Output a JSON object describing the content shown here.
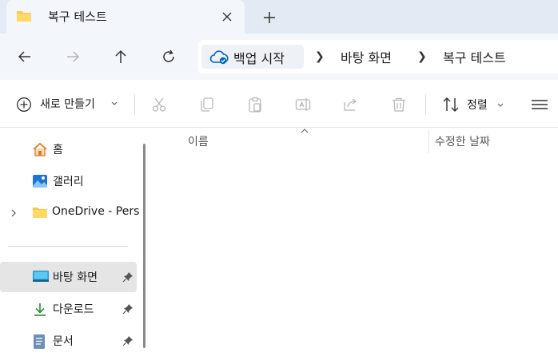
{
  "tab": {
    "title": "복구 테스트"
  },
  "address": {
    "root": "백업 시작",
    "crumbs": [
      "바탕 화면",
      "복구 테스트"
    ]
  },
  "toolbar": {
    "new_label": "새로 만들기",
    "sort_label": "정렬"
  },
  "nav": {
    "items": [
      {
        "label": "홈",
        "icon": "home-icon"
      },
      {
        "label": "갤러리",
        "icon": "gallery-icon"
      },
      {
        "label": "OneDrive - Pers",
        "icon": "folder-icon"
      },
      {
        "label": "바탕 화면",
        "icon": "desktop-icon"
      },
      {
        "label": "다운로드",
        "icon": "download-icon"
      },
      {
        "label": "문서",
        "icon": "document-icon"
      }
    ]
  },
  "columns": {
    "name": "이름",
    "date": "수정한 날짜"
  },
  "colors": {
    "accent": "#0067c0",
    "folder": "#f8c74a",
    "selected": "#e5e5e5"
  }
}
